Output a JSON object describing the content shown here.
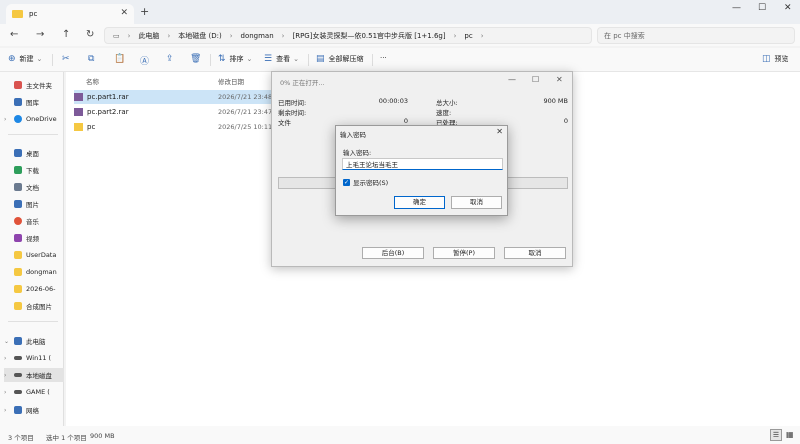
{
  "tab": {
    "label": "pc"
  },
  "nav": {
    "breadcrumbs": [
      "此电脑",
      "本地磁盘 (D:)",
      "dongman",
      "[RPG]女装灵探梨—依0.51官中步兵版 [1+1.6g]",
      "pc"
    ],
    "search_placeholder": "在 pc 中搜索"
  },
  "toolbar": {
    "new_label": "新建",
    "sort_label": "排序",
    "view_label": "查看",
    "extract_all_label": "全部解压缩",
    "more_label": "···",
    "preview_label": "预览"
  },
  "sidebar": {
    "items": [
      {
        "label": "主文件夹",
        "icon": "home-icon",
        "color": "#d9534f"
      },
      {
        "label": "图库",
        "icon": "gallery-icon",
        "color": "#3b6fb6"
      },
      {
        "label": "OneDrive",
        "icon": "cloud-icon",
        "color": "#1e88e5"
      },
      {
        "label": "桌面",
        "icon": "desktop-icon",
        "color": "#3b6fb6"
      },
      {
        "label": "下载",
        "icon": "download-icon",
        "color": "#2e9e5b"
      },
      {
        "label": "文档",
        "icon": "document-icon",
        "color": "#6b7a8f"
      },
      {
        "label": "图片",
        "icon": "picture-icon",
        "color": "#3b6fb6"
      },
      {
        "label": "音乐",
        "icon": "music-icon",
        "color": "#e0533a"
      },
      {
        "label": "视频",
        "icon": "video-icon",
        "color": "#8e44ad"
      },
      {
        "label": "UserData",
        "icon": "folder-icon",
        "color": "#f5c842"
      },
      {
        "label": "dongman",
        "icon": "folder-icon",
        "color": "#f5c842"
      },
      {
        "label": "2026-06-",
        "icon": "folder-icon",
        "color": "#f5c842"
      },
      {
        "label": "合成图片",
        "icon": "folder-icon",
        "color": "#f5c842"
      },
      {
        "label": "此电脑",
        "icon": "computer-icon",
        "color": "#3b6fb6"
      },
      {
        "label": "Win11 (",
        "icon": "drive-icon",
        "color": "#555555"
      },
      {
        "label": "本地磁盘",
        "icon": "drive-icon",
        "color": "#555555"
      },
      {
        "label": "GAME (",
        "icon": "drive-icon",
        "color": "#555555"
      },
      {
        "label": "网络",
        "icon": "network-icon",
        "color": "#3b6fb6"
      }
    ]
  },
  "list": {
    "col_name": "名称",
    "col_date": "修改日期",
    "rows": [
      {
        "name": "pc.part1.rar",
        "date": "2026/7/21 23:48",
        "type": "rar"
      },
      {
        "name": "pc.part2.rar",
        "date": "2026/7/21 23:47",
        "type": "rar"
      },
      {
        "name": "pc",
        "date": "2026/7/25 10:11",
        "type": "folder"
      }
    ]
  },
  "status": {
    "count": "3 个项目",
    "selected": "选中 1 个项目",
    "size": "900 MB"
  },
  "progress": {
    "title": "0% 正在打开...",
    "elapsed_label": "已用时间:",
    "elapsed_value": "00:00:03",
    "remaining_label": "剩余时间:",
    "files_label": "文件",
    "files_value": "0",
    "total_label": "总大小:",
    "total_value": "900 MB",
    "speed_label": "速度:",
    "processed_label": "已处理:",
    "processed_value": "0",
    "background_button": "后台(B)",
    "pause_button": "暂停(P)",
    "cancel_button": "取消"
  },
  "password": {
    "title": "输入密码",
    "label": "输入密码:",
    "value": "上毛王论坛当毛王",
    "show_label": "显示密码(S)",
    "ok_button": "确定",
    "cancel_button": "取消"
  }
}
